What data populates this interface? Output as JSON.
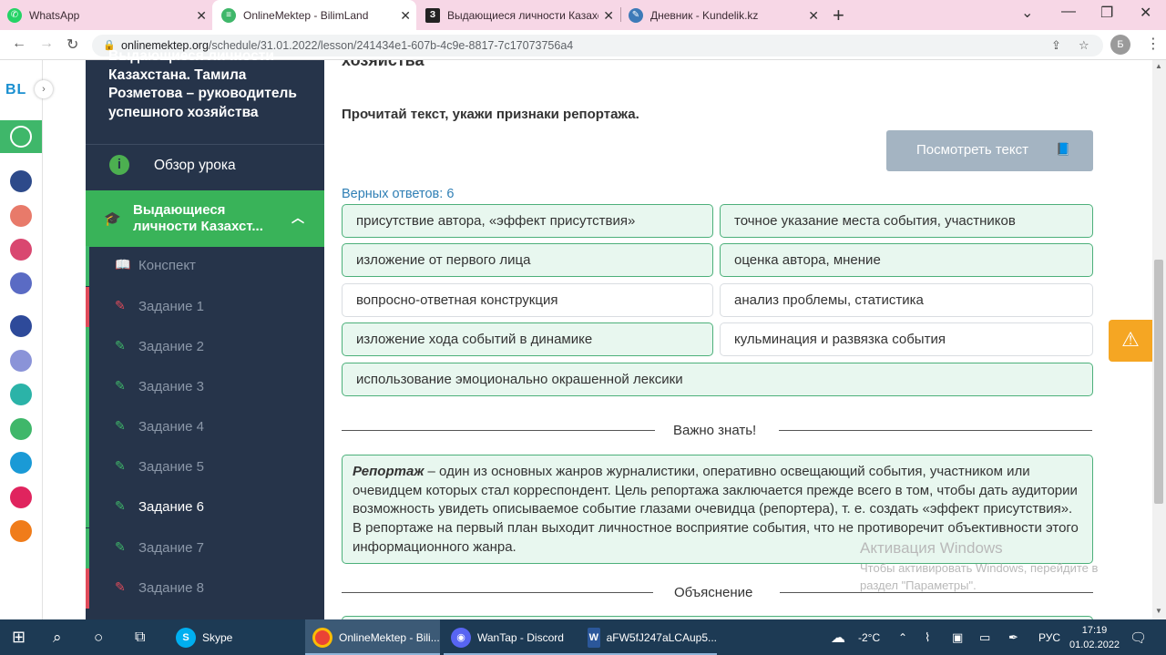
{
  "browser": {
    "tabs": [
      {
        "title": "WhatsApp",
        "icon": "whatsapp-icon",
        "color": "#25d366"
      },
      {
        "title": "OnlineMektep - BilimLand",
        "icon": "bilimland-icon",
        "color": "#3fb76a"
      },
      {
        "title": "Выдающиеся личности Казахст",
        "icon": "quizlet-icon",
        "color": "#222222"
      },
      {
        "title": "Дневник - Kundelik.kz",
        "icon": "kundelik-icon",
        "color": "#3d7ab8"
      }
    ],
    "url_domain": "onlinemektep.org",
    "url_path": "/schedule/31.01.2022/lesson/241434e1-607b-4c9e-8817-7c17073756a4",
    "avatar_letter": "Б"
  },
  "rail": {
    "logo": "BL",
    "apps": [
      {
        "name": "online-mektep",
        "color": "#3fb76a"
      },
      {
        "name": "bilim-media",
        "color": "#2d4a8a"
      },
      {
        "name": "bilim-class",
        "color": "#e87a6a"
      },
      {
        "name": "bilim-shop",
        "color": "#d94770"
      },
      {
        "name": "bilim-study",
        "color": "#5a6bc4"
      },
      {
        "name": "smart-nation",
        "color": "#2e4a9a"
      },
      {
        "name": "bilim-docs",
        "color": "#8a93d8"
      },
      {
        "name": "bilim-connect",
        "color": "#2bb3a8"
      },
      {
        "name": "bilim-land",
        "color": "#3fb76a"
      },
      {
        "name": "bilim-test",
        "color": "#1a9ad6"
      },
      {
        "name": "twig",
        "color": "#e0245e"
      },
      {
        "name": "bilim-mektep",
        "color": "#f07c1a"
      }
    ]
  },
  "sidebar": {
    "course_title": "Выдающиеся личности Казахстана. Тамила Розметова – руководитель успешного хозяйства",
    "overview": "Обзор урока",
    "section": "Выдающиеся личности Казахст...",
    "items": [
      {
        "label": "Конспект",
        "bar": "#3fb76a",
        "icon": "book-icon",
        "icolor": "#3fb76a"
      },
      {
        "label": "Задание 1",
        "bar": "#e04b5a",
        "icon": "edit-icon",
        "icolor": "#e04b5a"
      },
      {
        "label": "Задание 2",
        "bar": "#3fb76a",
        "icon": "edit-icon",
        "icolor": "#3fb76a"
      },
      {
        "label": "Задание 3",
        "bar": "#3fb76a",
        "icon": "edit-icon",
        "icolor": "#3fb76a"
      },
      {
        "label": "Задание 4",
        "bar": "#3fb76a",
        "icon": "edit-icon",
        "icolor": "#3fb76a"
      },
      {
        "label": "Задание 5",
        "bar": "#3fb76a",
        "icon": "edit-icon",
        "icolor": "#3fb76a"
      },
      {
        "label": "Задание 6",
        "bar": "#3fb76a",
        "icon": "edit-icon",
        "icolor": "#3fb76a"
      },
      {
        "label": "Задание 7",
        "bar": "#3fb76a",
        "icon": "edit-icon",
        "icolor": "#3fb76a"
      },
      {
        "label": "Задание 8",
        "bar": "#e04b5a",
        "icon": "edit-icon",
        "icolor": "#e04b5a"
      }
    ]
  },
  "main": {
    "top_title": "хозяйства",
    "question": "Прочитай текст, укажи признаки репортажа.",
    "view_text_button": "Посмотреть текст",
    "correct_label": "Верных ответов: 6",
    "answers": [
      {
        "text": "присутствие автора, «эффект присутствия»",
        "correct": true
      },
      {
        "text": "точное указание места события, участников",
        "correct": true
      },
      {
        "text": "изложение от первого лица",
        "correct": true
      },
      {
        "text": "оценка автора, мнение",
        "correct": true
      },
      {
        "text": "вопросно-ответная конструкция",
        "correct": false
      },
      {
        "text": "анализ проблемы, статистика",
        "correct": false
      },
      {
        "text": "изложение хода событий в динамике",
        "correct": true
      },
      {
        "text": "кульминация и развязка события",
        "correct": false
      },
      {
        "text": "использование эмоционально окрашенной лексики",
        "correct": true
      }
    ],
    "important_label": "Важно знать!",
    "note_term": "Репортаж",
    "note_text": " – один из основных жанров журналистики, оперативно освещающий события, участником или очевидцем которых стал корреспондент. Цель репортажа заключается прежде всего в том, чтобы дать аудитории возможность увидеть описываемое событие глазами очевидца (репортера), т. е. создать «эффект присутствия». В репортаже на первый план выходит личностное восприятие события, что не противоречит объективности этого информационного жанра.",
    "explanation_label": "Объяснение"
  },
  "watermark": {
    "title": "Активация Windows",
    "text": "Чтобы активировать Windows, перейдите в раздел \"Параметры\"."
  },
  "taskbar": {
    "apps": [
      {
        "label": "Skype",
        "color": "#00aff0",
        "icon": "skype-icon",
        "active": false
      },
      {
        "label": "OnlineMektep - Bili...",
        "color": "#ea4335",
        "icon": "chrome-icon",
        "active": true
      },
      {
        "label": "WanTap - Discord",
        "color": "#5865f2",
        "icon": "discord-icon",
        "active": false
      },
      {
        "label": "aFW5fJ247aLCAup5...",
        "color": "#2b579a",
        "icon": "word-icon",
        "active": false
      }
    ],
    "temperature": "-2°C",
    "lang": "РУС",
    "time": "17:19",
    "date": "01.02.2022"
  }
}
